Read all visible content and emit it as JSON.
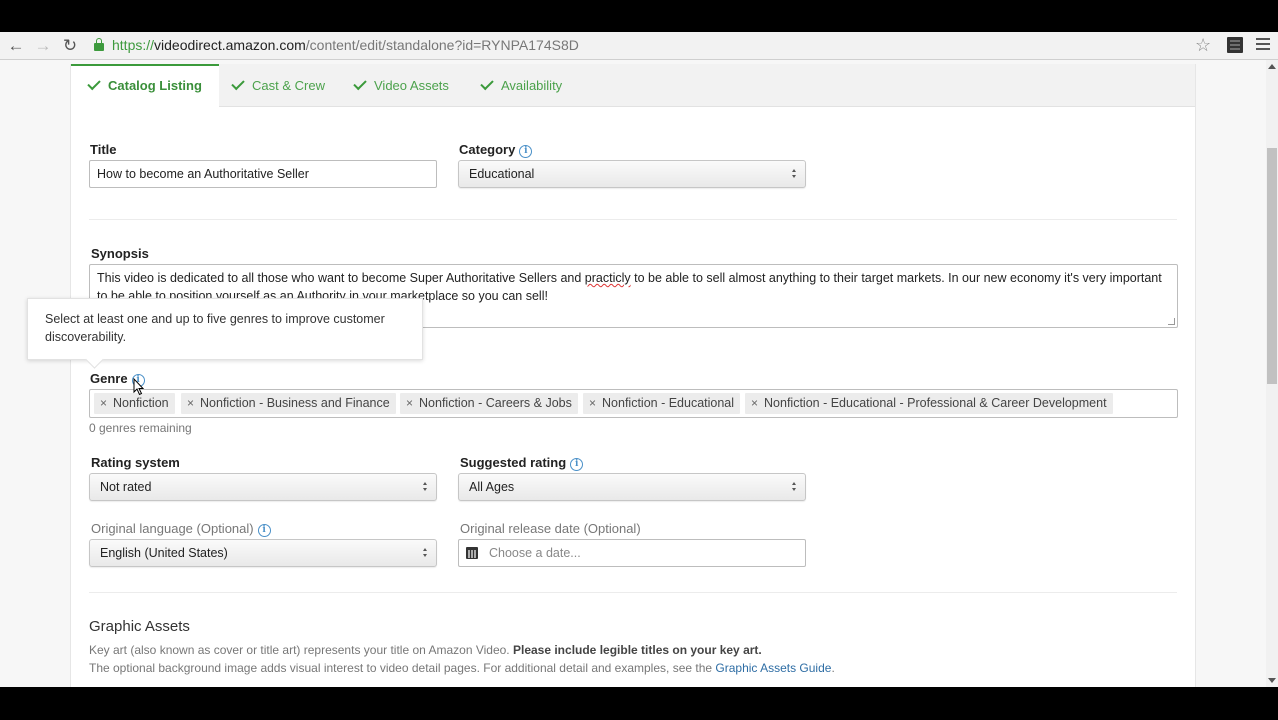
{
  "browser": {
    "url_scheme": "https://",
    "url_host": "videodirect.amazon.com",
    "url_path": "/content/edit/standalone?id=RYNPA174S8D",
    "icons": [
      "back-arrow-icon",
      "forward-arrow-icon",
      "reload-icon",
      "lock-icon",
      "bookmark-star-icon",
      "extension-film-icon",
      "hamburger-menu-icon"
    ]
  },
  "tabs": [
    {
      "label": "Catalog Listing",
      "state": "active",
      "complete": true
    },
    {
      "label": "Cast & Crew",
      "complete": true
    },
    {
      "label": "Video Assets",
      "complete": true
    },
    {
      "label": "Availability",
      "complete": true
    }
  ],
  "form": {
    "title_label": "Title",
    "title_value": "How to become an Authoritative Seller",
    "category_label": "Category",
    "category_value": "Educational",
    "synopsis_label": "Synopsis",
    "synopsis_before": "This video is dedicated to all those who want to become Super Authoritative Sellers and ",
    "synopsis_typo": "practicly",
    "synopsis_after": " to be able to sell almost anything to their target markets. In our new economy it's very important to be able to position yourself as an Authority in your marketplace so you can sell!",
    "tooltip_text": "Select at least one and up to five genres to improve customer discoverability.",
    "genre_label": "Genre",
    "genres": [
      "Nonfiction",
      "Nonfiction - Business and Finance",
      "Nonfiction - Careers & Jobs",
      "Nonfiction - Educational",
      "Nonfiction - Educational - Professional & Career Development"
    ],
    "genre_remove_symbol": "×",
    "genres_remaining": "0 genres remaining",
    "rating_system_label": "Rating system",
    "rating_system_value": "Not rated",
    "suggested_rating_label": "Suggested rating",
    "suggested_rating_value": "All Ages",
    "language_label": "Original language (Optional)",
    "language_value": "English (United States)",
    "release_date_label": "Original release date (Optional)",
    "release_date_placeholder": "Choose a date..."
  },
  "graphic_assets": {
    "title": "Graphic Assets",
    "line1_text": "Key art (also known as cover or title art) represents your title on Amazon Video. ",
    "line1_bold": "Please include legible titles on your key art.",
    "line2_text": "The optional background image adds visual interest to video detail pages. For additional detail and examples, see the ",
    "line2_link": "Graphic Assets Guide",
    "line2_end": "."
  },
  "info_symbol": "i",
  "colors": {
    "accent_green": "#3b9a3b",
    "info_blue": "#4a90c8",
    "link_blue": "#2e6da4"
  }
}
